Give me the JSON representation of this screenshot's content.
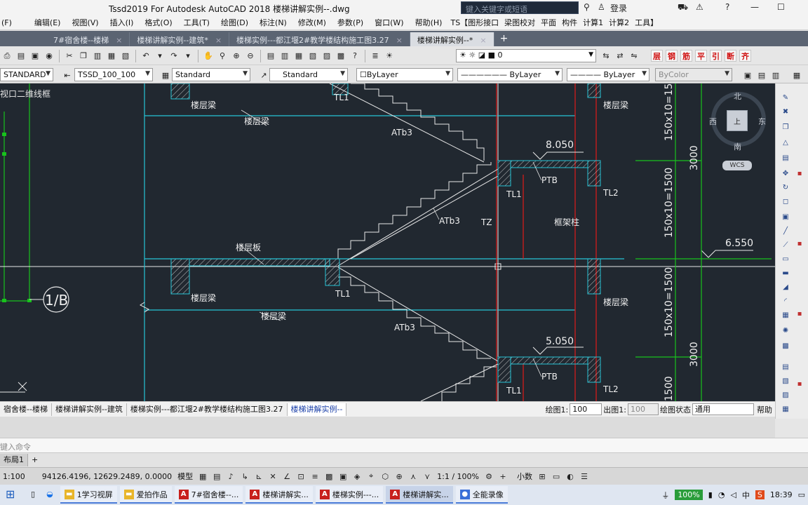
{
  "window": {
    "title": "Tssd2019 For Autodesk AutoCAD 2018    楼梯讲解实例--.dwg",
    "search_placeholder": "键入关键字或短语",
    "login": "登录"
  },
  "menu": [
    "(F)",
    "编辑(E)",
    "视图(V)",
    "插入(I)",
    "格式(O)",
    "工具(T)",
    "绘图(D)",
    "标注(N)",
    "修改(M)",
    "参数(P)",
    "窗口(W)",
    "帮助(H)",
    "TS【图形接口",
    "梁图校对",
    "平面",
    "构件",
    "计算1",
    "计算2",
    "工具】"
  ],
  "file_tabs": [
    {
      "label": "7#宿舍楼--楼梯",
      "active": false
    },
    {
      "label": "楼梯讲解实例--建筑*",
      "active": false
    },
    {
      "label": "楼梯实例---都江堰2#教学楼结构施工图3.27",
      "active": false
    },
    {
      "label": "楼梯讲解实例--*",
      "active": true
    }
  ],
  "toolbar": {
    "layer_value": "0",
    "tssd_icons": [
      "层",
      "钢",
      "筋",
      "平",
      "引",
      "断",
      "齐"
    ]
  },
  "props": {
    "textstyle": "STANDARD",
    "dimstyle": "TSSD_100_100",
    "tablestyle": "Standard",
    "mleaderstyle": "Standard",
    "color": "ByLayer",
    "linetype": "ByLayer",
    "lineweight": "ByLayer",
    "plotstyle": "ByColor"
  },
  "canvas": {
    "view_label": "视口二维线框",
    "labels": [
      {
        "id": "lcl1",
        "text": "楼层梁"
      },
      {
        "id": "lcl2",
        "text": "楼层梁"
      },
      {
        "id": "lcl3",
        "text": "楼层梁"
      },
      {
        "id": "lcl4",
        "text": "楼层梁"
      },
      {
        "id": "lcl5",
        "text": "楼层梁"
      },
      {
        "id": "lcl6",
        "text": "楼层梁"
      },
      {
        "id": "lcb",
        "text": "楼层板"
      },
      {
        "id": "tl1a",
        "text": "TL1"
      },
      {
        "id": "tl1b",
        "text": "TL1"
      },
      {
        "id": "tl1c",
        "text": "TL1"
      },
      {
        "id": "tl1d",
        "text": "TL1"
      },
      {
        "id": "tl2a",
        "text": "TL2"
      },
      {
        "id": "tl2b",
        "text": "TL2"
      },
      {
        "id": "atb3a",
        "text": "ATb3"
      },
      {
        "id": "atb3b",
        "text": "ATb3"
      },
      {
        "id": "atb3c",
        "text": "ATb3"
      },
      {
        "id": "ptb1",
        "text": "PTB"
      },
      {
        "id": "ptb2",
        "text": "PTB"
      },
      {
        "id": "tz",
        "text": "TZ"
      },
      {
        "id": "kjz",
        "text": "框架柱"
      },
      {
        "id": "e8050",
        "text": "8.050"
      },
      {
        "id": "e6550",
        "text": "6.550"
      },
      {
        "id": "e5050",
        "text": "5.050"
      },
      {
        "id": "v1",
        "text": "150x10=1500"
      },
      {
        "id": "v2",
        "text": "3000"
      },
      {
        "id": "v3",
        "text": "150x10=1500"
      },
      {
        "id": "v4",
        "text": "150x10=1500"
      },
      {
        "id": "v5",
        "text": "3000"
      },
      {
        "id": "v6",
        "text": "1500"
      },
      {
        "id": "axis",
        "text": "1/B"
      }
    ]
  },
  "viewcube": {
    "north": "北",
    "south": "南",
    "east": "东",
    "west": "西",
    "top": "上",
    "wcs": "WCS"
  },
  "layout_bar": {
    "tabs": [
      {
        "label": "宿舍楼--楼梯",
        "active": false
      },
      {
        "label": "楼梯讲解实例--建筑",
        "active": false
      },
      {
        "label": "楼梯实例---都江堰2#教学楼结构施工图3.27",
        "active": false
      },
      {
        "label": "楼梯讲解实例--",
        "active": true
      }
    ],
    "draw_scale_label": "绘图1:",
    "draw_scale": "100",
    "out_scale_label": "出图1:",
    "out_scale": "100",
    "state_label": "绘图状态",
    "state": "通用",
    "help": "帮助"
  },
  "command_line": {
    "placeholder": "键入命令"
  },
  "layout_tabs": [
    "布局1",
    "+"
  ],
  "status": {
    "scale": "1:100",
    "coords": "94126.4196, 12629.2489, 0.0000",
    "model": "模型",
    "anno_scale": "1:1 / 100%",
    "units": "小数"
  },
  "taskbar": {
    "items": [
      "1学习视屏",
      "爱拍作品",
      "7#宿舍楼--...",
      "楼梯讲解实...",
      "楼梯实例---...",
      "楼梯讲解实...",
      "全能录像"
    ],
    "battery": "100%",
    "lang": "中",
    "time": "18:39"
  }
}
